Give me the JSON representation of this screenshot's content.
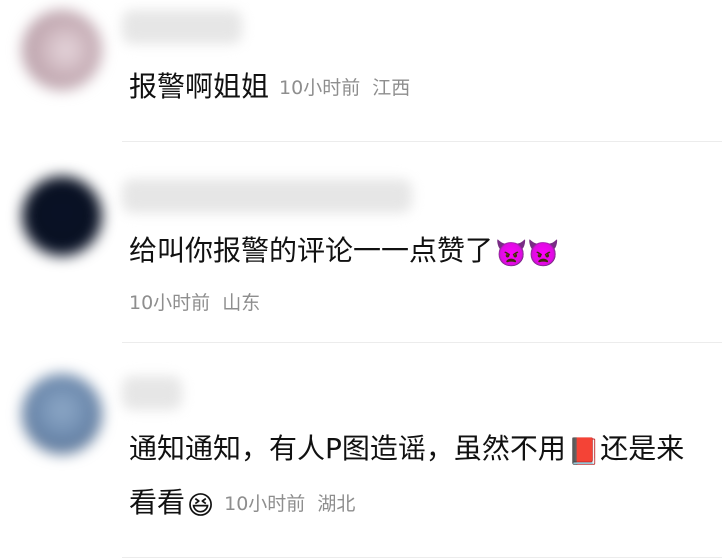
{
  "comments": [
    {
      "text": "报警啊姐姐",
      "time": "10小时前",
      "location": "江西"
    },
    {
      "text": "给叫你报警的评论一一点赞了",
      "emojis": "👿👿",
      "time": "10小时前",
      "location": "山东"
    },
    {
      "text_part1": "通知通知，有人P图造谣，虽然不用",
      "emoji_book": "📕",
      "text_part2": "还是来看看",
      "emoji_laugh": "😆",
      "time": "10小时前",
      "location": "湖北"
    }
  ],
  "icons": {
    "avatar_1_color": "#c9b1b9",
    "avatar_2_color": "#0a1226",
    "avatar_3_color": "#6c89ad"
  }
}
